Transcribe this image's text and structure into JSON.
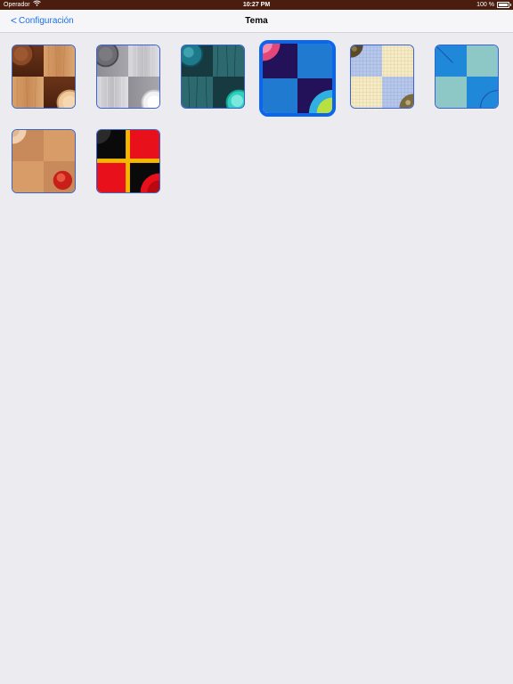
{
  "status_bar": {
    "carrier": "Operador",
    "time": "10:27 PM",
    "battery_text": "100 %",
    "battery_level": 1.0
  },
  "nav": {
    "back_label": "Configuración",
    "back_chevron": "<",
    "title": "Tema"
  },
  "themes": [
    {
      "id": "wood",
      "selected": false
    },
    {
      "id": "metal",
      "selected": false
    },
    {
      "id": "teal-wood",
      "selected": false
    },
    {
      "id": "blue-modern",
      "selected": true
    },
    {
      "id": "patchwork",
      "selected": false
    },
    {
      "id": "aqua",
      "selected": false
    },
    {
      "id": "cardboard",
      "selected": false
    },
    {
      "id": "red-black",
      "selected": false
    }
  ]
}
